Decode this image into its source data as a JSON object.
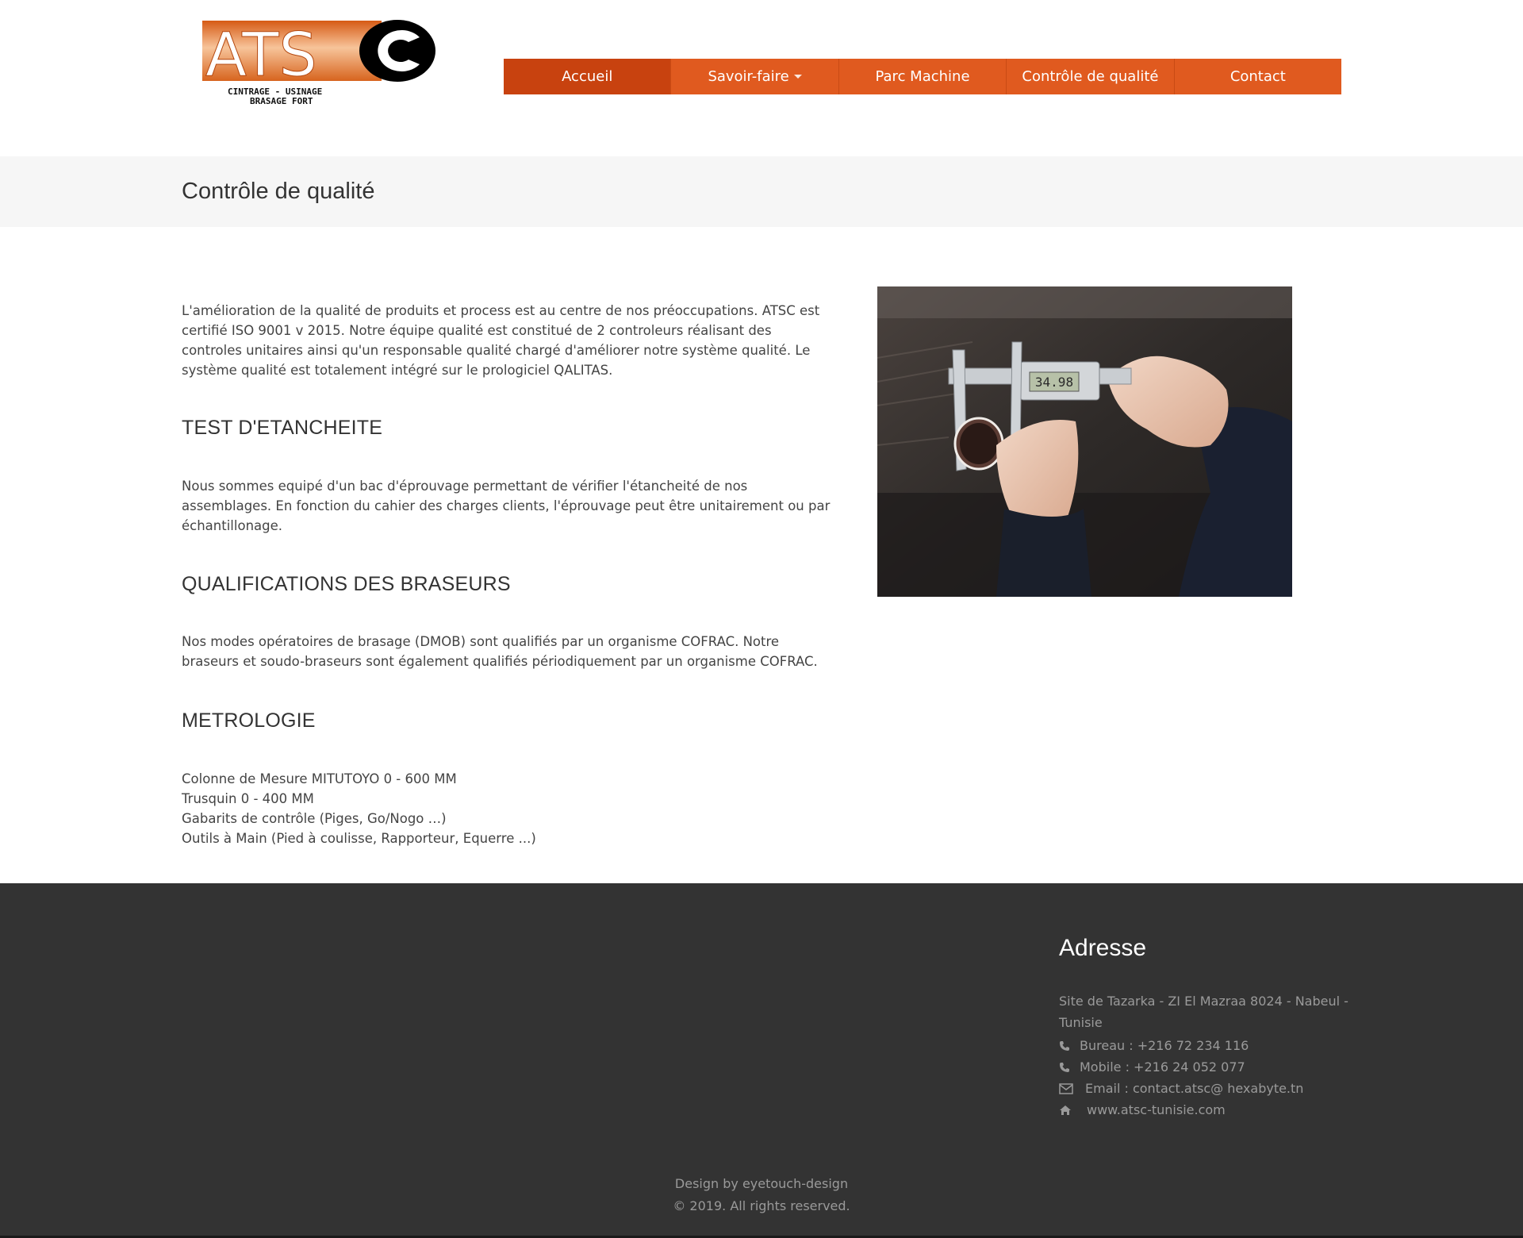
{
  "logo": {
    "letters": "ATSC",
    "tagline_line1": "CINTRAGE - USINAGE",
    "tagline_line2": "BRASAGE FORT"
  },
  "nav": {
    "items": [
      {
        "label": "Accueil",
        "active": true
      },
      {
        "label": "Savoir-faire",
        "has_dropdown": true
      },
      {
        "label": "Parc Machine"
      },
      {
        "label": "Contrôle de qualité"
      },
      {
        "label": "Contact"
      }
    ],
    "color": "#e05a1f",
    "active_color": "#c8420f"
  },
  "page": {
    "title": "Contrôle de qualité"
  },
  "main": {
    "intro": "L'amélioration de la qualité de produits et process est au centre de nos préoccupations. ATSC est certifié ISO 9001 v 2015. Notre équipe qualité est constitué de 2 controleurs réalisant des controles unitaires ainsi qu'un responsable qualité chargé d'améliorer notre système qualité. Le système qualité est totalement intégré sur le prologiciel QALITAS.",
    "sections": [
      {
        "heading": "TEST D'ETANCHEITE",
        "text": "Nous sommes equipé d'un bac d'éprouvage permettant de vérifier l'étancheité de nos assemblages. En fonction du cahier des charges clients, l'éprouvage peut être unitairement ou par échantillonage."
      },
      {
        "heading": "QUALIFICATIONS DES BRASEURS",
        "text": "Nos modes opératoires de brasage (DMOB) sont qualifiés par un organisme COFRAC. Notre braseurs et soudo-braseurs sont également qualifiés périodiquement par un organisme COFRAC."
      },
      {
        "heading": "METROLOGIE",
        "lines": [
          "Colonne de Mesure MITUTOYO 0 - 600 MM",
          "Trusquin 0 - 400 MM",
          "Gabarits de contrôle (Piges, Go/Nogo …)",
          "Outils à Main (Pied à coulisse, Rapporteur, Equerre ...)"
        ]
      }
    ],
    "caliper_reading": "34.98"
  },
  "footer": {
    "address_title": "Adresse",
    "address_line1": "Site de Tazarka - ZI El Mazraa 8024 - Nabeul -",
    "address_line2": "Tunisie",
    "contacts": [
      {
        "icon": "phone-icon",
        "text": "Bureau : +216 72 234 116"
      },
      {
        "icon": "phone-icon",
        "text": "Mobile : +216 24 052 077"
      },
      {
        "icon": "envelope-icon",
        "text": "Email : contact.atsc@ hexabyte.tn"
      },
      {
        "icon": "home-icon",
        "text": "www.atsc-tunisie.com"
      }
    ],
    "design_by": "Design by eyetouch-design",
    "copyright": "© 2019. All rights reserved."
  }
}
